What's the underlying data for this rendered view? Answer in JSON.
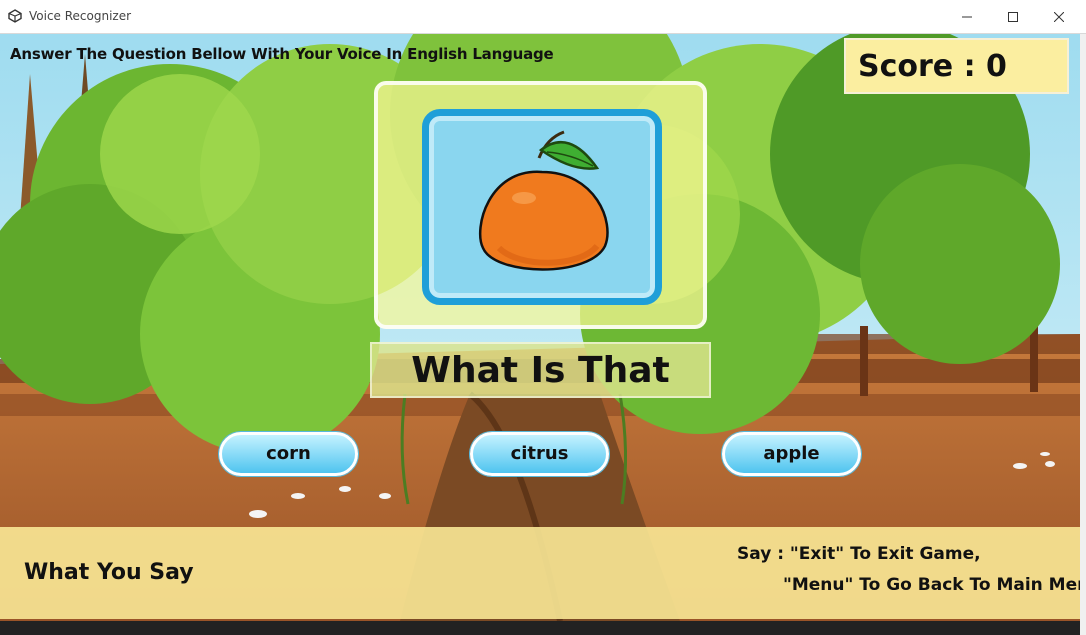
{
  "window": {
    "title": "Voice Recognizer",
    "controls": {
      "minimize": "–",
      "maximize": "☐",
      "close": "✕"
    }
  },
  "game": {
    "instruction": "Answer The Question Bellow With Your Voice In English Language",
    "score_label": "Score : 0",
    "score": 0,
    "question_image_icon": "orange-fruit-icon",
    "prompt": "What Is That",
    "answers": [
      {
        "label": "corn"
      },
      {
        "label": "citrus"
      },
      {
        "label": "apple"
      }
    ],
    "speech_display": "What You Say",
    "hint_line1": "Say : \"Exit\" To Exit Game,",
    "hint_line2": "\"Menu\" To Go Back To Main Menu,"
  },
  "colors": {
    "sky": "#aee3f3",
    "ground": "#b96a2f",
    "foliage": "#6fbf38",
    "answer_button": "#4fc4ef",
    "panel": "#fae896"
  }
}
